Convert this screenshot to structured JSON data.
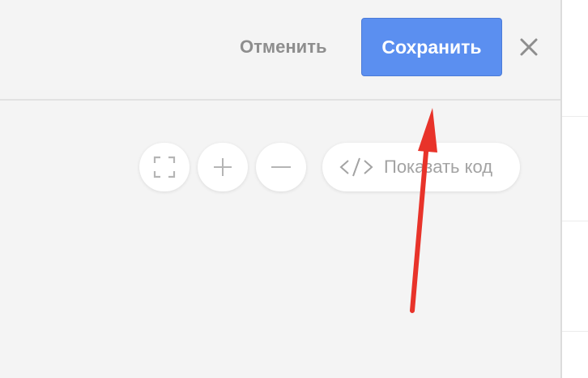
{
  "header": {
    "cancel_label": "Отменить",
    "save_label": "Сохранить",
    "close_icon": "close-icon"
  },
  "toolbar": {
    "fullscreen_icon": "fullscreen-icon",
    "zoom_in_icon": "plus-icon",
    "zoom_out_icon": "minus-icon",
    "show_code_label": "Показать код",
    "show_code_icon": "code-icon"
  },
  "annotation": {
    "arrow_icon": "red-arrow",
    "arrow_color": "#e8332a"
  },
  "colors": {
    "accent": "#5b8ff0",
    "background": "#f4f4f4",
    "muted_text": "#8e8e8e"
  }
}
